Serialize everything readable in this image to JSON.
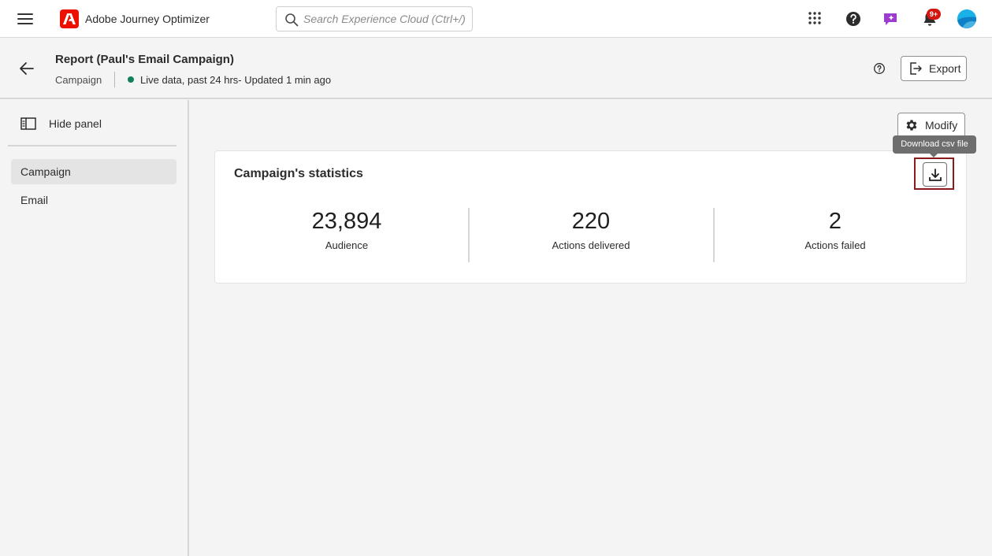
{
  "topbar": {
    "app_name": "Adobe Journey Optimizer",
    "search_placeholder": "Search Experience Cloud (Ctrl+/)",
    "notification_badge": "9+",
    "brand_color": "#eb1000"
  },
  "header": {
    "title": "Report (Paul's Email Campaign)",
    "breadcrumb": "Campaign",
    "status": "Live data, past 24 hrs- Updated 1 min ago",
    "status_color": "#12805c",
    "export_label": "Export"
  },
  "sidebar": {
    "hide_panel_label": "Hide panel",
    "items": [
      {
        "label": "Campaign",
        "selected": true
      },
      {
        "label": "Email",
        "selected": false
      }
    ]
  },
  "main": {
    "modify_label": "Modify",
    "tooltip": "Download csv file",
    "card": {
      "title": "Campaign's statistics",
      "metrics": [
        {
          "value": "23,894",
          "label": "Audience"
        },
        {
          "value": "220",
          "label": "Actions delivered"
        },
        {
          "value": "2",
          "label": "Actions failed"
        }
      ]
    }
  }
}
